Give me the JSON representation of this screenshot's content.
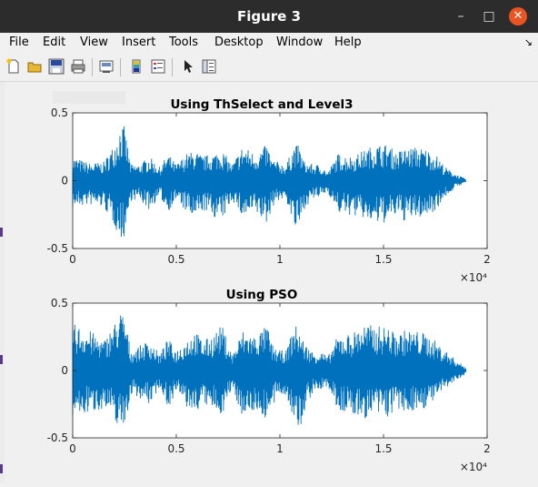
{
  "window": {
    "title": "Figure 3",
    "controls": {
      "minimize": "–",
      "maximize": "□",
      "close": "✕"
    }
  },
  "menu": {
    "items": [
      {
        "label": "File"
      },
      {
        "label": "Edit"
      },
      {
        "label": "View"
      },
      {
        "label": "Insert"
      },
      {
        "label": "Tools"
      },
      {
        "label": "Desktop"
      },
      {
        "label": "Window"
      },
      {
        "label": "Help"
      }
    ],
    "overflow_icon": "corner-arrow-icon"
  },
  "toolbar": {
    "icons": [
      "new-figure-icon",
      "open-file-icon",
      "save-icon",
      "print-icon",
      "link-plot-icon",
      "insert-colorbar-icon",
      "insert-legend-icon",
      "edit-plot-cursor-icon",
      "property-inspector-icon"
    ]
  },
  "colors": {
    "signal": "#0072bd",
    "titlebar": "#2c2c2c",
    "close_button": "#e95420"
  },
  "chart_data": [
    {
      "type": "line",
      "title": "Using ThSelect and Level3",
      "xlim": [
        0,
        20000
      ],
      "ylim": [
        -0.5,
        0.5
      ],
      "x_ticks": [
        "0",
        "0.5",
        "1",
        "1.5",
        "2"
      ],
      "y_ticks": [
        "0.5",
        "0",
        "-0.5"
      ],
      "x_exponent": "×10⁴",
      "x_extent": [
        0,
        19000
      ],
      "series": [
        {
          "envelope_x": [
            0,
            800,
            1500,
            2000,
            2300,
            2500,
            2800,
            3200,
            3700,
            4200,
            4600,
            5000,
            5500,
            5900,
            6300,
            6700,
            7200,
            7700,
            8200,
            8800,
            9400,
            9600,
            9900,
            10300,
            10700,
            10900,
            11200,
            11600,
            12000,
            12300,
            12800,
            13500,
            14000,
            14600,
            15200,
            15600,
            16000,
            16500,
            17000,
            17500,
            18000,
            18500,
            19000
          ],
          "envelope_upper": [
            0.18,
            0.13,
            0.14,
            0.27,
            0.42,
            0.4,
            0.12,
            0.12,
            0.18,
            0.1,
            0.2,
            0.12,
            0.2,
            0.22,
            0.18,
            0.2,
            0.23,
            0.12,
            0.26,
            0.2,
            0.27,
            0.16,
            0.14,
            0.12,
            0.27,
            0.26,
            0.14,
            0.12,
            0.12,
            0.06,
            0.2,
            0.18,
            0.22,
            0.27,
            0.27,
            0.21,
            0.24,
            0.25,
            0.24,
            0.2,
            0.1,
            0.05,
            0.01
          ],
          "envelope_lower": [
            -0.2,
            -0.18,
            -0.2,
            -0.33,
            -0.44,
            -0.42,
            -0.15,
            -0.14,
            -0.22,
            -0.12,
            -0.23,
            -0.14,
            -0.24,
            -0.3,
            -0.22,
            -0.26,
            -0.3,
            -0.14,
            -0.28,
            -0.24,
            -0.33,
            -0.2,
            -0.15,
            -0.14,
            -0.36,
            -0.38,
            -0.2,
            -0.14,
            -0.12,
            -0.08,
            -0.24,
            -0.26,
            -0.28,
            -0.33,
            -0.31,
            -0.26,
            -0.3,
            -0.28,
            -0.27,
            -0.22,
            -0.12,
            -0.05,
            -0.01
          ]
        }
      ]
    },
    {
      "type": "line",
      "title": "Using PSO",
      "xlim": [
        0,
        20000
      ],
      "ylim": [
        -0.5,
        0.5
      ],
      "x_ticks": [
        "0",
        "0.5",
        "1",
        "1.5",
        "2"
      ],
      "y_ticks": [
        "0.5",
        "0",
        "-0.5"
      ],
      "x_exponent": "×10⁴",
      "x_extent": [
        0,
        19000
      ],
      "series": [
        {
          "envelope_x": [
            0,
            800,
            1500,
            2000,
            2300,
            2500,
            2800,
            3200,
            3700,
            4200,
            4600,
            5000,
            5500,
            5900,
            6300,
            6700,
            7200,
            7700,
            8200,
            8800,
            9400,
            9600,
            9900,
            10300,
            10700,
            10900,
            11200,
            11600,
            12000,
            12300,
            12800,
            13500,
            14000,
            14600,
            15200,
            15600,
            16000,
            16500,
            17000,
            17500,
            18000,
            18500,
            19000
          ],
          "envelope_upper": [
            0.35,
            0.3,
            0.22,
            0.35,
            0.44,
            0.42,
            0.15,
            0.18,
            0.23,
            0.12,
            0.24,
            0.15,
            0.24,
            0.3,
            0.22,
            0.26,
            0.34,
            0.12,
            0.3,
            0.26,
            0.34,
            0.2,
            0.15,
            0.15,
            0.34,
            0.32,
            0.2,
            0.14,
            0.15,
            0.1,
            0.26,
            0.28,
            0.35,
            0.33,
            0.33,
            0.27,
            0.3,
            0.3,
            0.28,
            0.22,
            0.15,
            0.08,
            0.02
          ],
          "envelope_lower": [
            -0.36,
            -0.32,
            -0.28,
            -0.38,
            -0.42,
            -0.43,
            -0.18,
            -0.2,
            -0.26,
            -0.12,
            -0.28,
            -0.16,
            -0.28,
            -0.32,
            -0.25,
            -0.3,
            -0.33,
            -0.14,
            -0.34,
            -0.3,
            -0.37,
            -0.3,
            -0.2,
            -0.18,
            -0.4,
            -0.5,
            -0.3,
            -0.16,
            -0.15,
            -0.12,
            -0.3,
            -0.34,
            -0.36,
            -0.35,
            -0.35,
            -0.3,
            -0.33,
            -0.3,
            -0.28,
            -0.22,
            -0.14,
            -0.08,
            -0.02
          ]
        }
      ]
    }
  ]
}
